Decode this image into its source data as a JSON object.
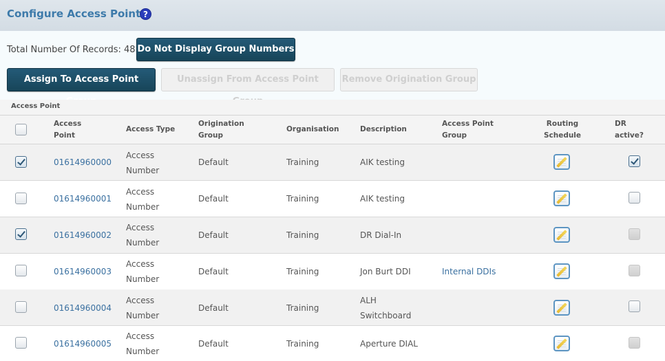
{
  "header": {
    "title": "Configure Access Points",
    "help_glyph": "?"
  },
  "toolbar": {
    "records_text": "Total Number Of Records: 48",
    "toggle_group_numbers_label": "Do Not Display Group Numbers",
    "assign_label": "Assign To Access Point Group",
    "unassign_label": "Unassign From Access Point Group",
    "remove_origination_label": "Remove Origination Group"
  },
  "table": {
    "section_label": "Access Point",
    "columns": {
      "access_point": "Access Point",
      "access_type": "Access Type",
      "origination_group": "Origination Group",
      "organisation": "Organisation",
      "description": "Description",
      "access_point_group": "Access Point Group",
      "routing_schedule": "Routing Schedule",
      "dr_active": "DR active?"
    },
    "rows": [
      {
        "selected": true,
        "access_point": "01614960000",
        "access_type": "Access Number",
        "origination_group": "Default",
        "organisation": "Training",
        "description": "AIK testing",
        "access_point_group": "",
        "dr_active": "checked"
      },
      {
        "selected": false,
        "access_point": "01614960001",
        "access_type": "Access Number",
        "origination_group": "Default",
        "organisation": "Training",
        "description": "AIK testing",
        "access_point_group": "",
        "dr_active": "unchecked"
      },
      {
        "selected": true,
        "access_point": "01614960002",
        "access_type": "Access Number",
        "origination_group": "Default",
        "organisation": "Training",
        "description": "DR Dial-In",
        "access_point_group": "",
        "dr_active": "disabled"
      },
      {
        "selected": false,
        "access_point": "01614960003",
        "access_type": "Access Number",
        "origination_group": "Default",
        "organisation": "Training",
        "description": "Jon Burt DDI",
        "access_point_group": "Internal DDIs",
        "dr_active": "disabled"
      },
      {
        "selected": false,
        "access_point": "01614960004",
        "access_type": "Access Number",
        "origination_group": "Default",
        "organisation": "Training",
        "description": "ALH Switchboard",
        "access_point_group": "",
        "dr_active": "unchecked"
      },
      {
        "selected": false,
        "access_point": "01614960005",
        "access_type": "Access Number",
        "origination_group": "Default",
        "organisation": "Training",
        "description": "Aperture DIAL",
        "access_point_group": "",
        "dr_active": "disabled"
      }
    ]
  },
  "colors": {
    "title": "#3d7aaa",
    "primary_button": "#1d4f68",
    "link": "#3a70a0"
  },
  "icons": {
    "help": "help-icon",
    "routing_schedule": "edit-schedule-icon"
  }
}
